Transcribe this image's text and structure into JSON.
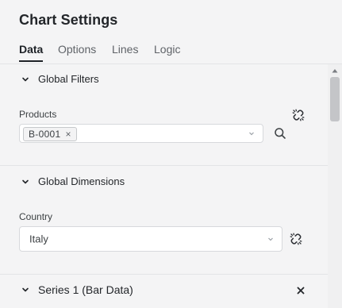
{
  "panel": {
    "title": "Chart Settings"
  },
  "tabs": [
    {
      "label": "Data",
      "active": true
    },
    {
      "label": "Options",
      "active": false
    },
    {
      "label": "Lines",
      "active": false
    },
    {
      "label": "Logic",
      "active": false
    }
  ],
  "global_filters": {
    "heading": "Global Filters",
    "products": {
      "label": "Products",
      "chips": [
        "B-0001"
      ]
    }
  },
  "global_dimensions": {
    "heading": "Global Dimensions",
    "country": {
      "label": "Country",
      "value": "Italy"
    }
  },
  "series": [
    {
      "heading": "Series 1 (Bar Data)"
    }
  ],
  "icons": {
    "unlink": "unlink-icon",
    "search": "search-icon",
    "chevron": "chevron-down-icon",
    "close": "close-icon"
  },
  "colors": {
    "background": "#f4f4f5",
    "text": "#1f2328",
    "border": "#d7d9dc"
  }
}
